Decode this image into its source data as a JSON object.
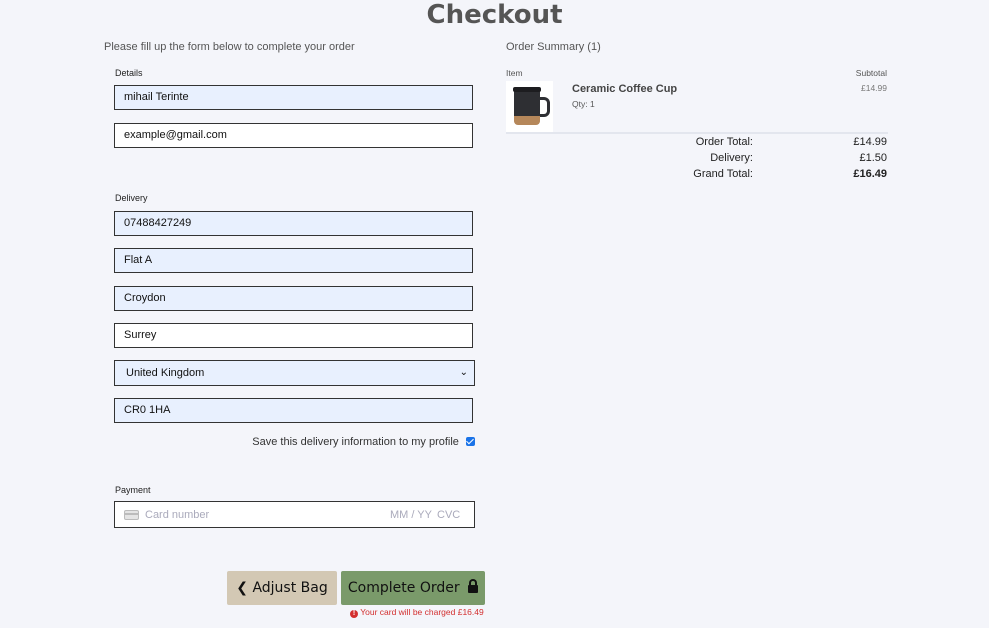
{
  "page": {
    "title": "Checkout",
    "intro": "Please fill up the form below to complete your order"
  },
  "details": {
    "label": "Details",
    "full_name": "mihail Terinte",
    "email": "example@gmail.com"
  },
  "delivery": {
    "label": "Delivery",
    "phone": "07488427249",
    "address_line1": "Flat A",
    "town": "Croydon",
    "county": "Surrey",
    "country": "United Kingdom",
    "postcode": "CR0 1HA",
    "save_label": "Save this delivery information to my profile",
    "save_checked": true
  },
  "payment": {
    "label": "Payment",
    "card_number_placeholder": "Card number",
    "expiry_placeholder": "MM / YY",
    "cvc_placeholder": "CVC"
  },
  "buttons": {
    "adjust_bag": "Adjust Bag",
    "complete_order": "Complete Order",
    "charge_note": "Your card will be charged £16.49"
  },
  "summary": {
    "title": "Order Summary (1)",
    "item_header": "Item",
    "subtotal_header": "Subtotal",
    "items": [
      {
        "name": "Ceramic Coffee Cup",
        "qty": "Qty: 1",
        "subtotal": "£14.99"
      }
    ],
    "order_total_label": "Order Total:",
    "order_total": "£14.99",
    "delivery_label": "Delivery:",
    "delivery_cost": "£1.50",
    "grand_total_label": "Grand Total:",
    "grand_total": "£16.49"
  },
  "colors": {
    "background": "#f4f5fa",
    "autofill_field": "#e8f0fe",
    "adjust_button": "#d3c8b4",
    "complete_button": "#7a9a6a",
    "warning": "#d32f2f"
  }
}
